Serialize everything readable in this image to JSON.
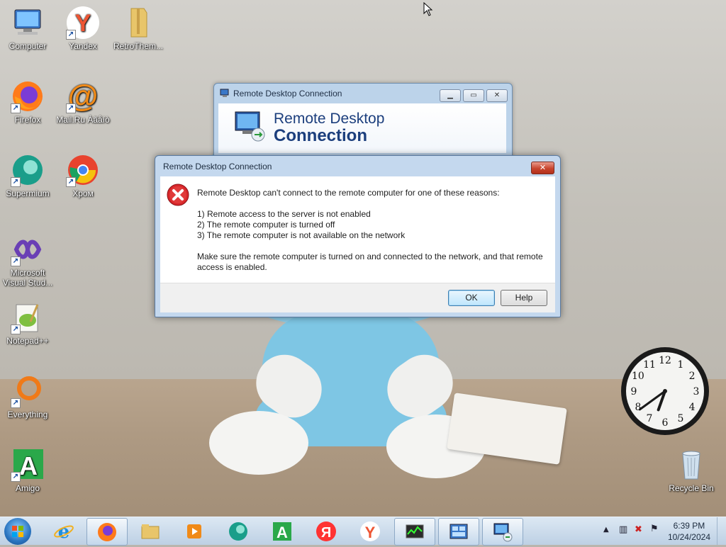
{
  "desktop": {
    "icons": [
      {
        "label": "Computer",
        "icon": "computer-icon"
      },
      {
        "label": "Yandex",
        "icon": "yandex-browser-icon"
      },
      {
        "label": "RetroThem...",
        "icon": "folder-icon"
      },
      {
        "label": "Firefox",
        "icon": "firefox-icon"
      },
      {
        "label": "Mail.Ru Àãåíò",
        "icon": "mailru-agent-icon"
      },
      {
        "label": "Supermium",
        "icon": "supermium-icon"
      },
      {
        "label": "Хром",
        "icon": "chrome-icon"
      },
      {
        "label": "Microsoft Visual Stud...",
        "icon": "visual-studio-icon"
      },
      {
        "label": "Notepad++",
        "icon": "notepadpp-icon"
      },
      {
        "label": "Everything",
        "icon": "everything-icon"
      },
      {
        "label": "Amigo",
        "icon": "amigo-icon"
      },
      {
        "label": "Recycle Bin",
        "icon": "recycle-bin-icon"
      }
    ]
  },
  "background_window": {
    "title": "Remote Desktop Connection",
    "banner_line1": "Remote Desktop",
    "banner_line2": "Connection"
  },
  "dialog": {
    "title": "Remote Desktop Connection",
    "intro": "Remote Desktop can't connect to the remote computer for one of these reasons:",
    "reasons": [
      "1) Remote access to the server is not enabled",
      "2) The remote computer is turned off",
      "3) The remote computer is not available on the network"
    ],
    "advice": "Make sure the remote computer is turned on and connected to the network, and that remote access is enabled.",
    "ok_label": "OK",
    "help_label": "Help"
  },
  "clock_gadget": {
    "numbers": [
      "12",
      "1",
      "2",
      "3",
      "4",
      "5",
      "6",
      "7",
      "8",
      "9",
      "10",
      "11"
    ],
    "hour_hand": 6.65,
    "minute_hand": 39
  },
  "taskbar": {
    "items": [
      {
        "icon": "internet-explorer-icon",
        "active": false
      },
      {
        "icon": "firefox-icon",
        "active": true
      },
      {
        "icon": "file-explorer-icon",
        "active": false
      },
      {
        "icon": "media-player-icon",
        "active": false
      },
      {
        "icon": "supermium-icon",
        "active": false
      },
      {
        "icon": "amigo-icon",
        "active": false
      },
      {
        "icon": "yandex-ya-icon",
        "active": false
      },
      {
        "icon": "yandex-browser-icon",
        "active": false
      },
      {
        "icon": "task-manager-icon",
        "active": true
      },
      {
        "icon": "control-panel-icon",
        "active": true
      },
      {
        "icon": "remote-desktop-icon",
        "active": true
      }
    ],
    "time": "6:39 PM",
    "date": "10/24/2024"
  }
}
